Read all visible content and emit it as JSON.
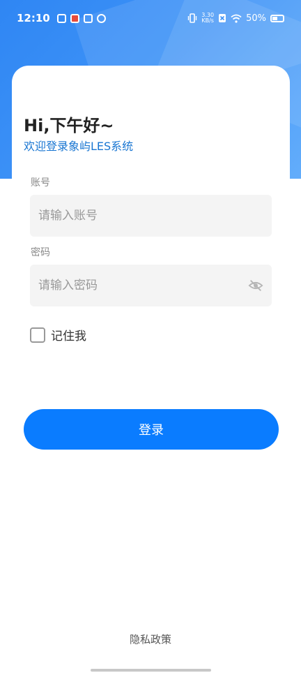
{
  "status_bar": {
    "time": "12:10",
    "net_speed_value": "3.30",
    "net_speed_unit": "KB/s",
    "battery_percent": "50%"
  },
  "login": {
    "greeting": "Hi,下午好~",
    "welcome": "欢迎登录象屿LES系统",
    "account_label": "账号",
    "account_placeholder": "请输入账号",
    "account_value": "",
    "password_label": "密码",
    "password_placeholder": "请输入密码",
    "password_value": "",
    "remember_label": "记住我",
    "remember_checked": false,
    "submit_label": "登录"
  },
  "footer": {
    "privacy_link": "隐私政策"
  },
  "colors": {
    "primary": "#0a7cff",
    "welcome_text": "#1976d2",
    "hero_gradient_start": "#2f86f3",
    "hero_gradient_end": "#63adfb"
  },
  "icons": {
    "password_toggle": "eye-off-icon"
  }
}
